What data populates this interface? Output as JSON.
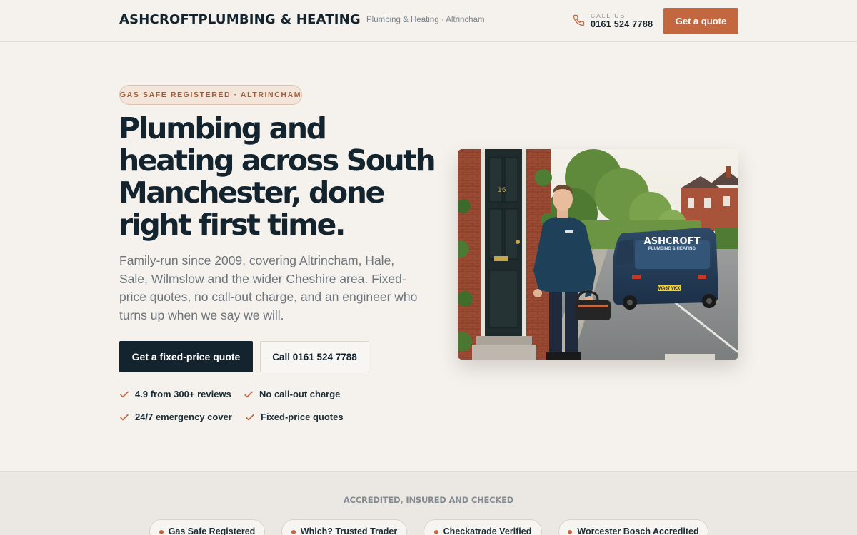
{
  "header": {
    "brand": "ASHCROFTPLUMBING & HEATING",
    "tagline": "Plumbing & Heating · Altrincham",
    "call_label": "CALL US",
    "call_number": "0161 524 7788",
    "cta": "Get a quote"
  },
  "hero": {
    "badge": "GAS SAFE REGISTERED · ALTRINCHAM",
    "title": "Plumbing and heating across South Manchester, done right first time.",
    "subtitle": "Family-run since 2009, covering Altrincham, Hale, Sale, Wilmslow and the wider Cheshire area. Fixed-price quotes, no call-out charge, and an engineer who turns up when we say we will.",
    "primary_button": "Get a fixed-price quote",
    "secondary_button": "Call 0161 524 7788",
    "features": [
      "4.9 from 300+ reviews",
      "No call-out charge",
      "24/7 emergency cover",
      "Fixed-price quotes"
    ],
    "image": {
      "van_brand": "ASHCROFT",
      "van_sub": "PLUMBING & HEATING",
      "plate": "WA67 VKX",
      "door_number": "16"
    }
  },
  "accreditations": {
    "title": "ACCREDITED, INSURED AND CHECKED",
    "items": [
      "Gas Safe Registered",
      "Which? Trusted Trader",
      "Checkatrade Verified",
      "Worcester Bosch Accredited"
    ]
  },
  "colors": {
    "accent": "#c2673f",
    "navy": "#13242e",
    "background": "#f5f2ee"
  }
}
